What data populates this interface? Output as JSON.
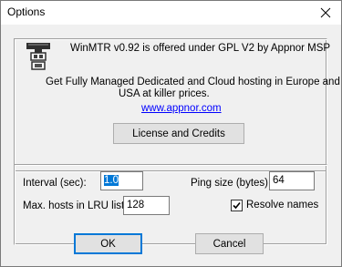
{
  "window": {
    "title": "Options"
  },
  "about": {
    "license_line": "WinMTR v0.92 is offered under GPL V2 by Appnor MSP",
    "hosting_line1": "Get Fully Managed Dedicated and Cloud hosting in Europe and",
    "hosting_line2": "USA at killer prices.",
    "link_text": "www.appnor.com",
    "license_button": "License and Credits"
  },
  "settings": {
    "interval_label": "Interval (sec):",
    "interval_value": "1.0",
    "ping_size_label": "Ping size (bytes):",
    "ping_size_value": "64",
    "max_hosts_label": "Max. hosts in LRU list:",
    "max_hosts_value": "128",
    "resolve_names_label": "Resolve names",
    "resolve_names_checked": true
  },
  "buttons": {
    "ok": "OK",
    "cancel": "Cancel"
  }
}
